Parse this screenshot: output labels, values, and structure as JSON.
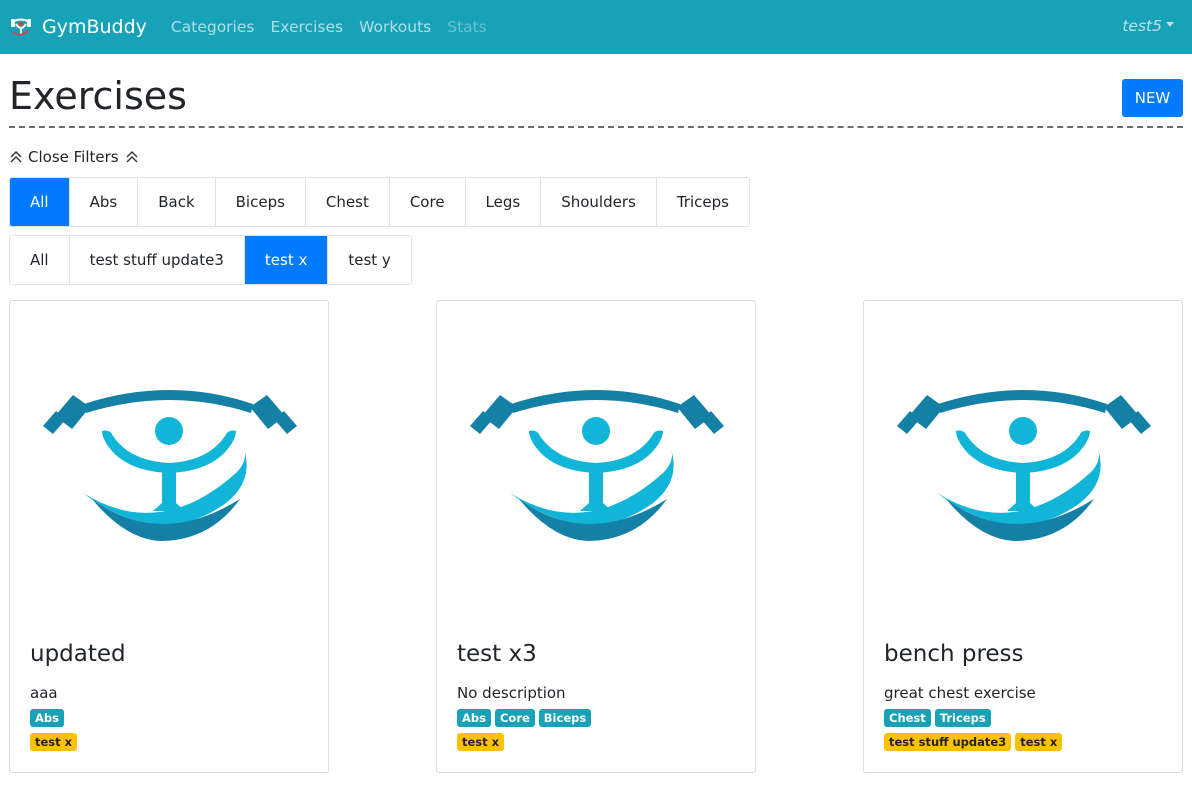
{
  "navbar": {
    "brand": "GymBuddy",
    "links": [
      "Categories",
      "Exercises",
      "Workouts",
      "Stats"
    ],
    "user": "test5"
  },
  "header": {
    "title": "Exercises",
    "new_label": "NEW"
  },
  "filters": {
    "toggle_label": "Close Filters",
    "categories": [
      "All",
      "Abs",
      "Back",
      "Biceps",
      "Chest",
      "Core",
      "Legs",
      "Shoulders",
      "Triceps"
    ],
    "active_category": "All",
    "tags": [
      "All",
      "test stuff update3",
      "test x",
      "test y"
    ],
    "active_tag": "test x"
  },
  "cards": [
    {
      "title": "updated",
      "description": "aaa",
      "categories": [
        "Abs"
      ],
      "tags": [
        "test x"
      ]
    },
    {
      "title": "test x3",
      "description": "No description",
      "categories": [
        "Abs",
        "Core",
        "Biceps"
      ],
      "tags": [
        "test x"
      ]
    },
    {
      "title": "bench press",
      "description": "great chest exercise",
      "categories": [
        "Chest",
        "Triceps"
      ],
      "tags": [
        "test stuff update3",
        "test x"
      ]
    }
  ],
  "colors": {
    "navbar": "#17a2b8",
    "primary": "#007bff",
    "category_badge": "#17a2b8",
    "tag_badge": "#ffc107",
    "logo_dark": "#1580a5",
    "logo_light": "#10b5d8"
  }
}
